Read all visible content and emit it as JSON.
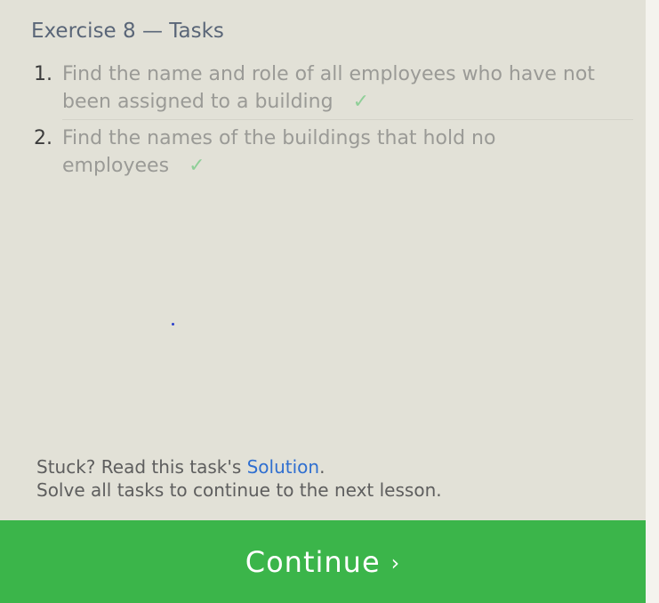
{
  "heading": "Exercise 8 — Tasks",
  "tasks": [
    {
      "number": "1.",
      "text": "Find the name and role of all employees who have not been assigned to a building",
      "check": "✓"
    },
    {
      "number": "2.",
      "text": "Find the names of the buildings that hold no employees",
      "check": "✓"
    }
  ],
  "footer": {
    "stuck_prefix": "Stuck? Read this task's ",
    "solution_link": "Solution",
    "stuck_suffix": ".",
    "continue_note": "Solve all tasks to continue to the next lesson."
  },
  "continue_button": {
    "label": "Continue",
    "chevron": "›"
  },
  "colors": {
    "panel_bg": "#e2e1d7",
    "button_green": "#3bb54a",
    "check_green": "#8fcf98",
    "link_blue": "#2f6fd0"
  }
}
